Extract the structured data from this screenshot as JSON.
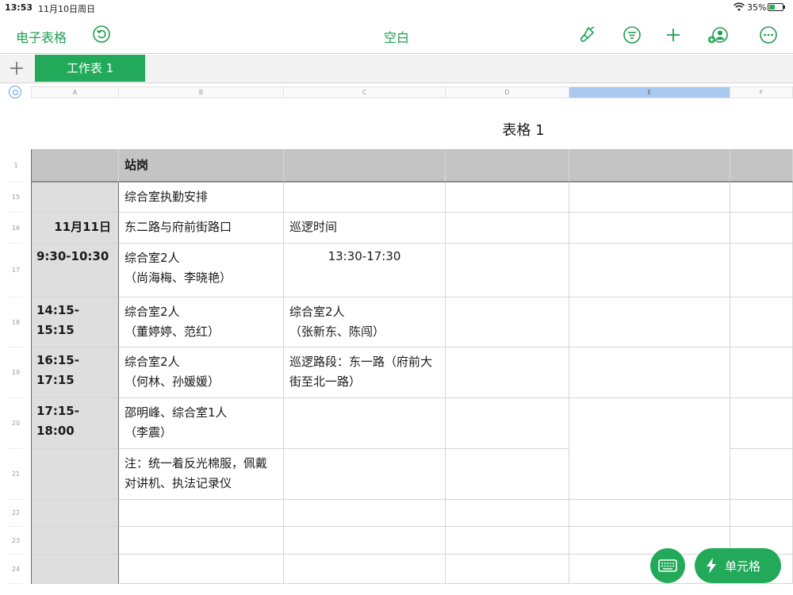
{
  "status_bar": {
    "time": "13:53",
    "date": "11月10日周日",
    "battery": "35%"
  },
  "toolbar": {
    "back_label": "电子表格",
    "title": "空白"
  },
  "tabs": {
    "add_icon": "plus-icon",
    "sheet_tab": "工作表 1"
  },
  "columns": [
    "A",
    "B",
    "C",
    "D",
    "E",
    "F"
  ],
  "selected_column": "E",
  "row_numbers": [
    "1",
    "15",
    "16",
    "17",
    "18",
    "19",
    "20",
    "21",
    "22",
    "23",
    "24"
  ],
  "table": {
    "title": "表格 1",
    "header": [
      "",
      "站岗",
      "",
      "",
      "",
      ""
    ],
    "rows": [
      [
        "",
        "综合室执勤安排",
        "",
        "",
        "",
        ""
      ],
      [
        "11月11日",
        "东二路与府前街路口",
        "巡逻时间",
        "",
        "",
        ""
      ],
      [
        "9:30-10:30",
        "综合室2人\n（尚海梅、李晓艳）",
        "13:30-17:30",
        "",
        "",
        ""
      ],
      [
        "14:15-15:15",
        "综合室2人\n（董婷婷、范红）",
        "综合室2人\n（张新东、陈闯）",
        "",
        "",
        ""
      ],
      [
        "16:15-17:15",
        "综合室2人\n（何林、孙媛媛）",
        "巡逻路段：东一路（府前大街至北一路）",
        "",
        "",
        ""
      ],
      [
        "17:15-18:00",
        "邵明峰、综合室1人\n（李震）",
        "",
        "",
        "",
        ""
      ],
      [
        "",
        "注：统一着反光棉服，佩戴对讲机、执法记录仪",
        "",
        "",
        "",
        ""
      ],
      [
        "",
        "",
        "",
        "",
        "",
        ""
      ],
      [
        "",
        "",
        "",
        "",
        "",
        ""
      ],
      [
        "",
        "",
        "",
        "",
        "",
        ""
      ]
    ]
  },
  "floating_buttons": {
    "keyboard_icon": "keyboard-icon",
    "cell_label": "单元格"
  },
  "colors": {
    "accent": "#22a95a",
    "header_fill": "#c4c4c4",
    "rowlabel_fill": "#dedede",
    "selected_col": "#a9c9f1"
  }
}
